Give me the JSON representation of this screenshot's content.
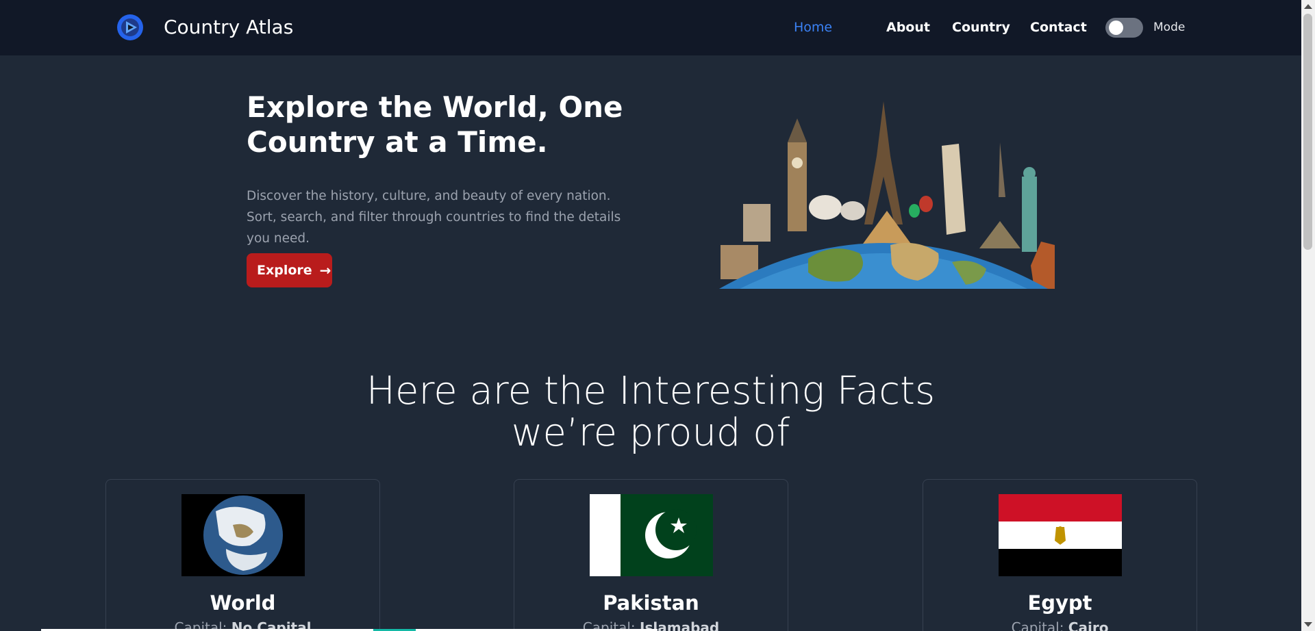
{
  "navbar": {
    "brand": "Country Atlas",
    "links": [
      "Home",
      "About",
      "Country",
      "Contact"
    ],
    "active_link": "Home",
    "mode_label": "Mode",
    "mode_toggle_on": false
  },
  "hero": {
    "title": "Explore the World, One Country at a Time.",
    "description": "Discover the history, culture, and beauty of every nation. Sort, search, and filter through countries to find the details you need.",
    "button_label": "Explore",
    "button_icon": "arrow-right-icon",
    "image": "world-landmarks-globe"
  },
  "facts": {
    "title": "Here are the Interesting Facts we’re proud of",
    "capital_prefix": "Capital:",
    "cards": [
      {
        "name": "World",
        "capital": "No Capital",
        "flag": "earth-globe"
      },
      {
        "name": "Pakistan",
        "capital": "Islamabad",
        "flag": "flag-pakistan"
      },
      {
        "name": "Egypt",
        "capital": "Cairo",
        "flag": "flag-egypt"
      }
    ]
  },
  "colors": {
    "page_bg": "#1f2937",
    "navbar_bg": "#111827",
    "accent": "#3b82f6",
    "button_bg": "#b91c1c",
    "muted_text": "#9ca3af"
  }
}
